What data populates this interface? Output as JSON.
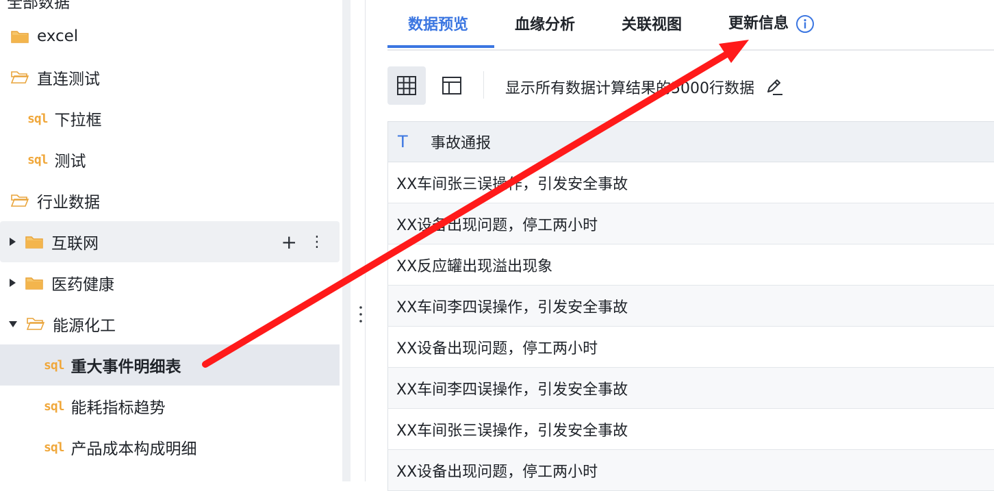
{
  "sidebar": {
    "root_label": "全部数据",
    "items": [
      {
        "label": "excel",
        "type": "folder"
      },
      {
        "label": "直连测试",
        "type": "folder-open"
      },
      {
        "label": "下拉框",
        "type": "sql"
      },
      {
        "label": "测试",
        "type": "sql"
      },
      {
        "label": "行业数据",
        "type": "folder-open"
      },
      {
        "label": "互联网",
        "type": "folder"
      },
      {
        "label": "医药健康",
        "type": "folder"
      },
      {
        "label": "能源化工",
        "type": "folder-open"
      },
      {
        "label": "重大事件明细表",
        "type": "sql",
        "selected": true
      },
      {
        "label": "能耗指标趋势",
        "type": "sql"
      },
      {
        "label": "产品成本构成明细",
        "type": "sql"
      }
    ],
    "sql_badge": "sql",
    "add_glyph": "+",
    "more_glyph": "⋮"
  },
  "tabs": [
    {
      "label": "数据预览",
      "active": true
    },
    {
      "label": "血缘分析"
    },
    {
      "label": "关联视图"
    },
    {
      "label": "更新信息"
    }
  ],
  "toolbar": {
    "info_text": "显示所有数据计算结果的5000行数据"
  },
  "table": {
    "column_type_glyph": "T",
    "column": "事故通报",
    "rows": [
      "XX车间张三误操作，引发安全事故",
      "XX设备出现问题，停工两小时",
      "XX反应罐出现溢出现象",
      "XX车间李四误操作，引发安全事故",
      "XX设备出现问题，停工两小时",
      "XX车间李四误操作，引发安全事故",
      "XX车间张三误操作，引发安全事故",
      "XX设备出现问题，停工两小时"
    ]
  },
  "colors": {
    "accent": "#3b76e1",
    "folder": "#f0a73a",
    "annotation_arrow": "#ff1a1a"
  }
}
